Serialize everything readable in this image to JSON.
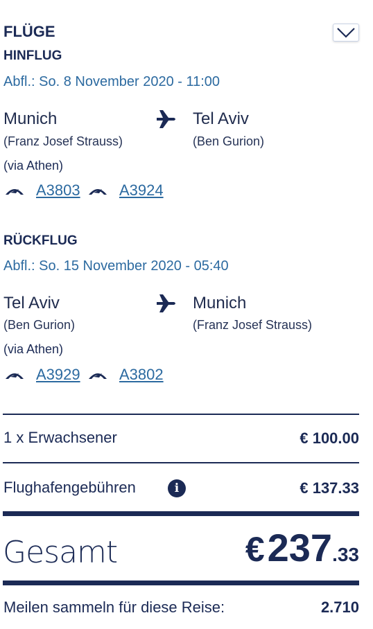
{
  "flights": {
    "title": "FLÜGE",
    "outbound": {
      "heading": "HINFLUG",
      "departure": "Abfl.: So. 8 November 2020 - 11:00",
      "from_city": "Munich",
      "from_airport": "(Franz Josef Strauss)",
      "to_city": "Tel Aviv",
      "to_airport": "(Ben Gurion)",
      "via": "(via Athen)",
      "flight_numbers": [
        "A3803",
        "A3924"
      ]
    },
    "return": {
      "heading": "RÜCKFLUG",
      "departure": "Abfl.: So. 15 November 2020 - 05:40",
      "from_city": "Tel Aviv",
      "from_airport": "(Ben Gurion)",
      "to_city": "Munich",
      "to_airport": "(Franz Josef Strauss)",
      "via": "(via Athen)",
      "flight_numbers": [
        "A3929",
        "A3802"
      ]
    }
  },
  "pricing": {
    "passengers_label": "1 x Erwachsener",
    "passengers_value": "€ 100.00",
    "fees_label": "Flughafengebühren",
    "fees_value": "€ 137.33",
    "total_label": "Gesamt",
    "total_currency": "€",
    "total_integer": "237",
    "total_decimal": ".33",
    "miles_label": "Meilen sammeln für diese Reise:",
    "miles_value": "2.710"
  },
  "icons": {
    "expand": "chevron-down-icon",
    "plane": "airplane-icon",
    "airline": "airline-logo-icon",
    "info": "info-icon"
  },
  "colors": {
    "navy": "#1b2a55",
    "link_blue": "#2c6aa0"
  }
}
